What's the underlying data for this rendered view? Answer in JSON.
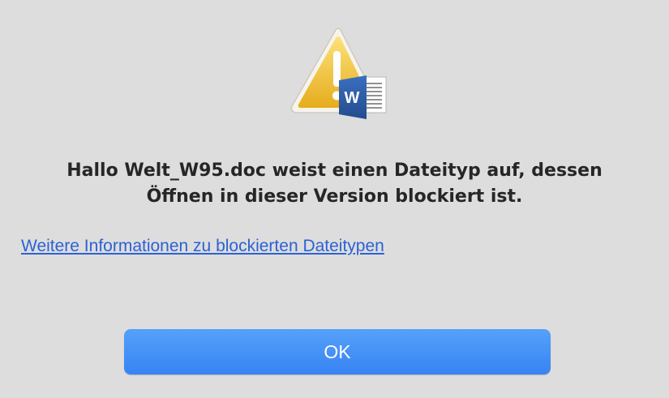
{
  "dialog": {
    "icon": {
      "warning": "warning-triangle-icon",
      "app": "word-document-icon",
      "app_letter": "W"
    },
    "message_line1": "Hallo Welt_W95.doc weist einen Dateityp auf, dessen",
    "message_line2": "Öffnen in dieser Version blockiert ist.",
    "link_text": "Weitere Informationen zu blockierten Dateitypen",
    "ok_label": "OK"
  },
  "colors": {
    "background": "#dedddd",
    "link": "#2a62d6",
    "button": "#3b87f5",
    "warning": "#f2c12e",
    "word_blue": "#2b579a"
  }
}
